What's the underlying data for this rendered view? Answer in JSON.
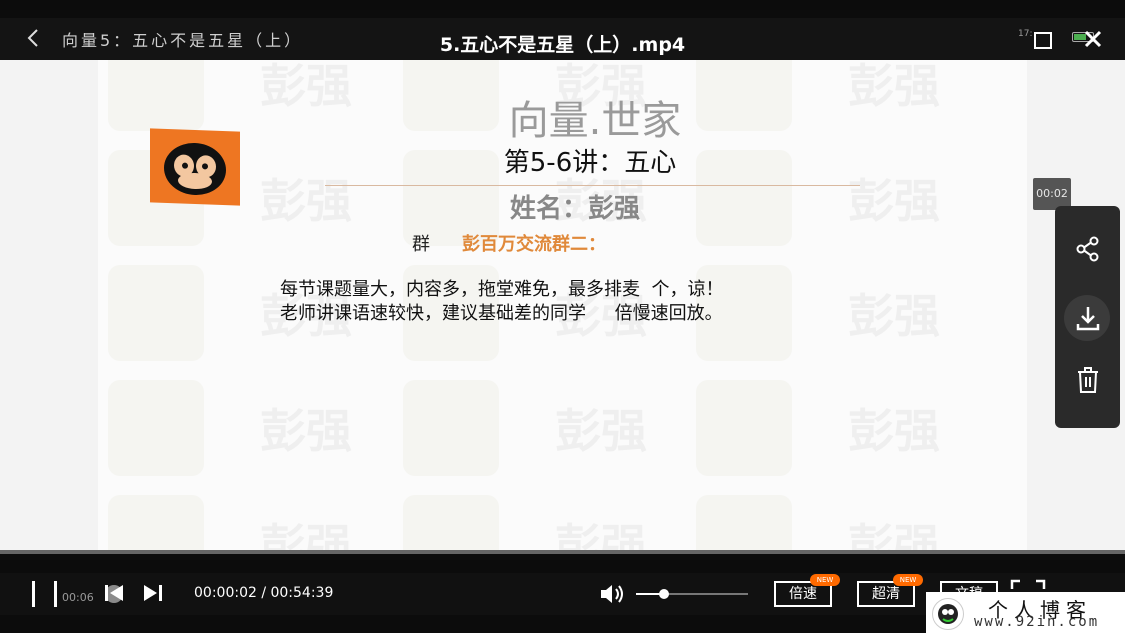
{
  "window": {
    "breadcrumb": "向量5：五心不是五星（上）",
    "video_title": "5.五心不是五星（上）.mp4",
    "clock": "17:"
  },
  "slide": {
    "brand": "向量.世家",
    "lecture_title": "第5-6讲：五心",
    "author": "姓名：彭强",
    "group_label": "群",
    "group_name": "彭百万交流群二：",
    "notice_line_1": "每节课题量大，内容多，拖堂难免，最多排麦  个，谅！",
    "notice_line_2": "老师讲课语速较快，建议基础差的同学     倍慢速回放。",
    "watermark_text": "彭强"
  },
  "side_menu": {
    "time_badge": "00:02",
    "items": [
      "share-icon",
      "download-icon",
      "trash-icon"
    ]
  },
  "controls": {
    "hover_time": "00:06",
    "current_time": "00:00:02",
    "total_time": "00:54:39",
    "time_display": "00:00:02 / 00:54:39",
    "progress_fraction": 0.0006,
    "volume_fraction": 0.25,
    "speed_label": "倍速",
    "quality_label": "超清",
    "subtitle_label": "文稿",
    "new_badge": "NEW"
  },
  "blog_badge": {
    "title": "个人博客",
    "url": "www.92in.com"
  },
  "colors": {
    "accent": "#ee7622",
    "group_name": "#e0893a",
    "new_badge": "#ff6a00"
  }
}
